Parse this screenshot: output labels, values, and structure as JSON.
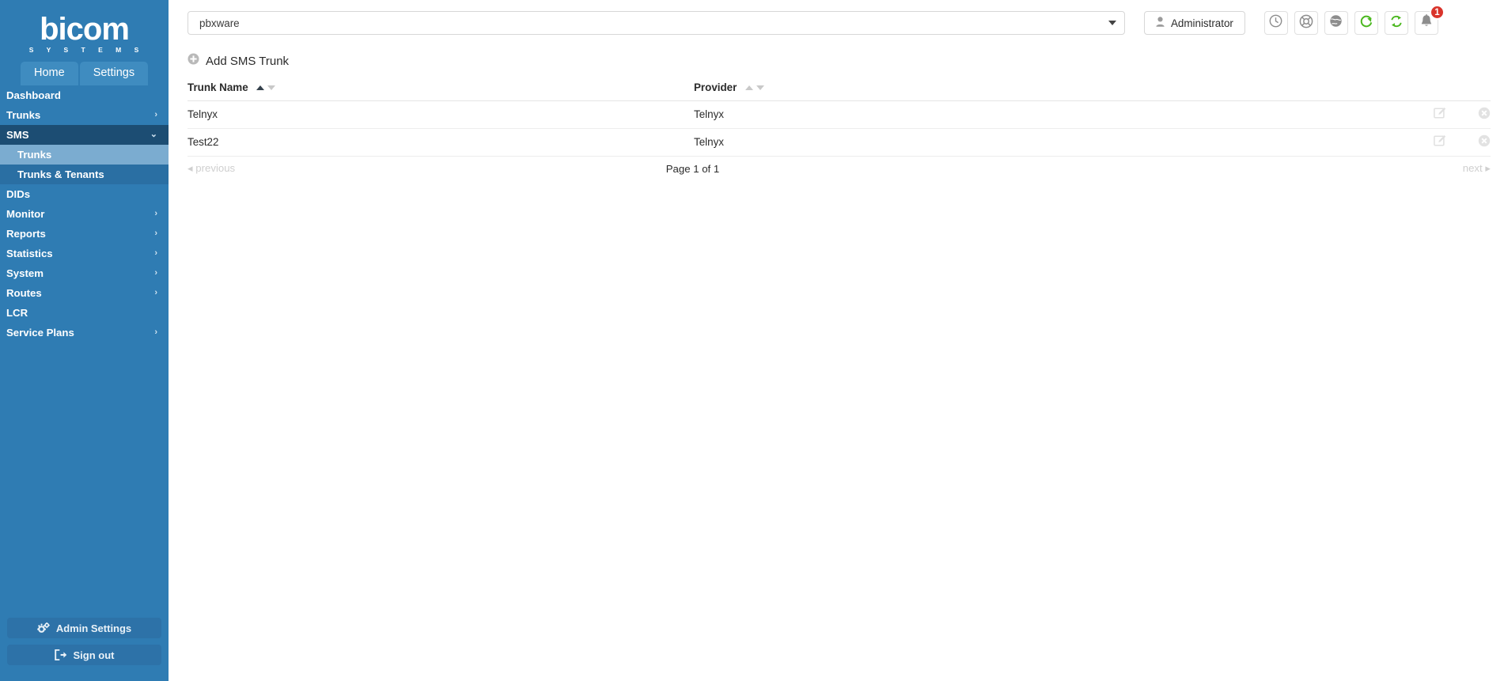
{
  "brand": {
    "name": "bicom",
    "tagline": "S Y S T E M S"
  },
  "tabs": [
    {
      "label": "Home",
      "active": true
    },
    {
      "label": "Settings",
      "active": false
    }
  ],
  "sidebar": {
    "items": [
      {
        "label": "Dashboard",
        "expandable": false,
        "state": "normal"
      },
      {
        "label": "Trunks",
        "expandable": true,
        "state": "normal"
      },
      {
        "label": "SMS",
        "expandable": true,
        "state": "open"
      },
      {
        "label": "DIDs",
        "expandable": false,
        "state": "normal"
      },
      {
        "label": "Monitor",
        "expandable": true,
        "state": "normal"
      },
      {
        "label": "Reports",
        "expandable": true,
        "state": "normal"
      },
      {
        "label": "Statistics",
        "expandable": true,
        "state": "normal"
      },
      {
        "label": "System",
        "expandable": true,
        "state": "normal"
      },
      {
        "label": "Routes",
        "expandable": true,
        "state": "normal"
      },
      {
        "label": "LCR",
        "expandable": false,
        "state": "normal"
      },
      {
        "label": "Service Plans",
        "expandable": true,
        "state": "normal"
      }
    ],
    "sms_submenu": [
      {
        "label": "Trunks",
        "active": true
      },
      {
        "label": "Trunks & Tenants",
        "active": false
      }
    ],
    "admin_settings_label": "Admin Settings",
    "sign_out_label": "Sign out"
  },
  "topbar": {
    "server_select_value": "pbxware",
    "user_label": "Administrator",
    "icons": [
      {
        "name": "clock-icon"
      },
      {
        "name": "lifebuoy-icon"
      },
      {
        "name": "globe-icon"
      },
      {
        "name": "reload-icon"
      },
      {
        "name": "sync-icon"
      },
      {
        "name": "bell-icon",
        "badge": "1"
      }
    ]
  },
  "content": {
    "add_button_label": "Add SMS Trunk",
    "table": {
      "columns": [
        {
          "label": "Trunk Name",
          "sort": "asc"
        },
        {
          "label": "Provider",
          "sort": "none"
        }
      ],
      "rows": [
        {
          "trunk_name": "Telnyx",
          "provider": "Telnyx"
        },
        {
          "trunk_name": "Test22",
          "provider": "Telnyx"
        }
      ]
    },
    "pagination": {
      "previous_label": "previous",
      "page_info": "Page 1 of 1",
      "next_label": "next"
    }
  },
  "colors": {
    "sidebar_bg": "#2f7cb3",
    "sidebar_active": "#1c4d73",
    "submenu_active": "#7bacd0",
    "badge_red": "#d9342b",
    "refresh_green": "#4cb820"
  }
}
